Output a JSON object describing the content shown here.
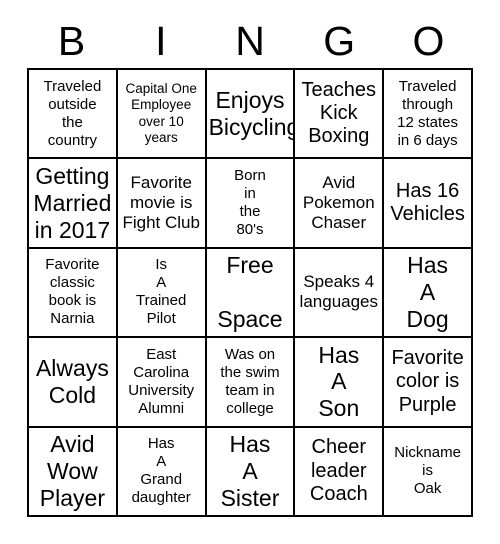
{
  "card": {
    "title": "BINGO",
    "columns": [
      "B",
      "I",
      "N",
      "G",
      "O"
    ],
    "free_space_index": 12,
    "colors": {
      "background": "#ffffff",
      "border": "#000000",
      "text": "#000000"
    },
    "grid_size": "5x5",
    "cells": [
      {
        "text": "Traveled\noutside\nthe\ncountry",
        "size": "sm"
      },
      {
        "text": "Capital One\nEmployee\nover 10\nyears",
        "size": "xs"
      },
      {
        "text": "Enjoys\nBicycling",
        "size": "xl"
      },
      {
        "text": "Teaches\nKick\nBoxing",
        "size": "lg"
      },
      {
        "text": "Traveled\nthrough\n12 states\nin 6 days",
        "size": "sm"
      },
      {
        "text": "Getting\nMarried\nin 2017",
        "size": "xl"
      },
      {
        "text": "Favorite\nmovie is\nFight Club",
        "size": "md"
      },
      {
        "text": "Born\nin\nthe\n80's",
        "size": "sm"
      },
      {
        "text": "Avid\nPokemon\nChaser",
        "size": "md"
      },
      {
        "text": "Has 16\nVehicles",
        "size": "lg"
      },
      {
        "text": "Favorite\nclassic\nbook is\nNarnia",
        "size": "sm"
      },
      {
        "text": "Is\nA\nTrained\nPilot",
        "size": "sm"
      },
      {
        "text": "Free\n\nSpace",
        "size": "free"
      },
      {
        "text": "Speaks 4\nlanguages",
        "size": "md"
      },
      {
        "text": "Has\nA\nDog",
        "size": "xl"
      },
      {
        "text": "Always\nCold",
        "size": "xl"
      },
      {
        "text": "East\nCarolina\nUniversity\nAlumni",
        "size": "sm"
      },
      {
        "text": "Was on\nthe swim\nteam in\ncollege",
        "size": "sm"
      },
      {
        "text": "Has\nA\nSon",
        "size": "xl"
      },
      {
        "text": "Favorite\ncolor is\nPurple",
        "size": "lg"
      },
      {
        "text": "Avid\nWow\nPlayer",
        "size": "xl"
      },
      {
        "text": "Has\nA\nGrand\ndaughter",
        "size": "sm"
      },
      {
        "text": "Has\nA\nSister",
        "size": "xl"
      },
      {
        "text": "Cheer\nleader\nCoach",
        "size": "lg"
      },
      {
        "text": "Nickname\nis\nOak",
        "size": "sm"
      }
    ]
  }
}
